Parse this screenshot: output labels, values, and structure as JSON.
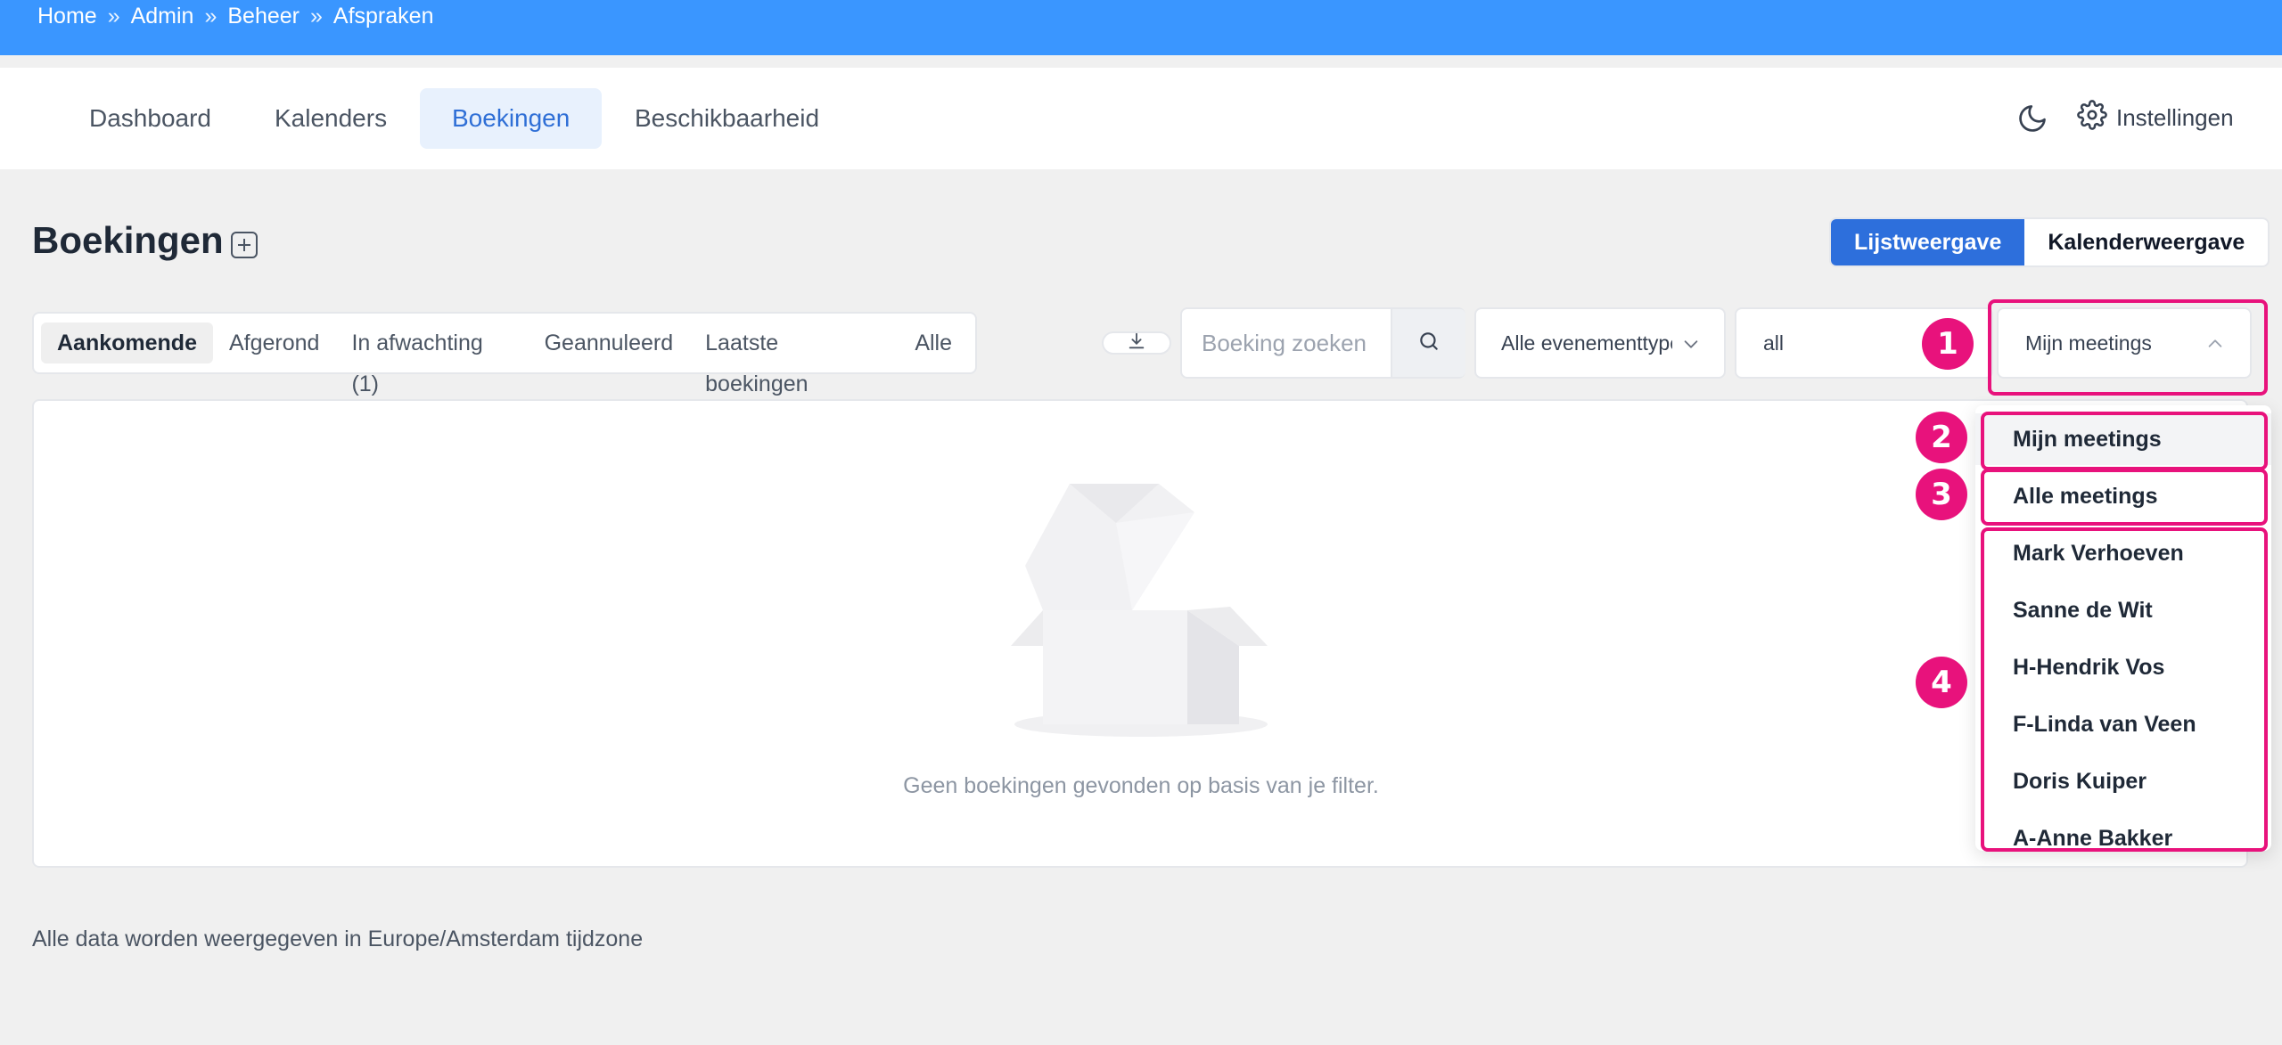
{
  "breadcrumb": [
    {
      "label": "Home"
    },
    {
      "label": "Admin"
    },
    {
      "label": "Beheer"
    },
    {
      "label": "Afspraken"
    }
  ],
  "breadcrumb_separator": "»",
  "nav": {
    "tabs": [
      {
        "label": "Dashboard",
        "active": false
      },
      {
        "label": "Kalenders",
        "active": false
      },
      {
        "label": "Boekingen",
        "active": true
      },
      {
        "label": "Beschikbaarheid",
        "active": false
      }
    ],
    "theme_icon": "moon-icon",
    "settings_label": "Instellingen"
  },
  "page": {
    "title": "Boekingen",
    "view_switch": {
      "list": "Lijstweergave",
      "calendar": "Kalenderweergave",
      "active": "list"
    }
  },
  "filter_tabs": [
    {
      "label": "Aankomende",
      "active": true
    },
    {
      "label": "Afgerond",
      "active": false
    },
    {
      "label": "In afwachting (1)",
      "active": false
    },
    {
      "label": "Geannuleerd",
      "active": false
    },
    {
      "label": "Laatste boekingen",
      "active": false
    },
    {
      "label": "Alle",
      "active": false
    }
  ],
  "search": {
    "placeholder": "Boeking zoeken",
    "value": ""
  },
  "event_type_select": {
    "value": "Alle evenementtype"
  },
  "status_select": {
    "value": "all"
  },
  "meetings_select": {
    "value": "Mijn meetings",
    "expanded": true
  },
  "meetings_options": [
    {
      "label": "Mijn meetings",
      "selected": true
    },
    {
      "label": "Alle meetings",
      "selected": false
    },
    {
      "label": "Mark Verhoeven",
      "selected": false
    },
    {
      "label": "Sanne de Wit",
      "selected": false
    },
    {
      "label": "H-Hendrik Vos",
      "selected": false
    },
    {
      "label": "F-Linda van Veen",
      "selected": false
    },
    {
      "label": "Doris Kuiper",
      "selected": false
    },
    {
      "label": "A-Anne Bakker",
      "selected": false
    }
  ],
  "empty_state": {
    "message": "Geen boekingen gevonden op basis van je filter."
  },
  "timezone_note": "Alle data worden weergegeven in Europe/Amsterdam tijdzone",
  "annotations": [
    {
      "number": "1"
    },
    {
      "number": "2"
    },
    {
      "number": "3"
    },
    {
      "number": "4"
    }
  ],
  "colors": {
    "topbar": "#3a96ff",
    "primary": "#2d6fdc",
    "active_nav_bg": "#e8f1fd",
    "annotation": "#e8127c",
    "page_bg": "#f0f0f0"
  }
}
